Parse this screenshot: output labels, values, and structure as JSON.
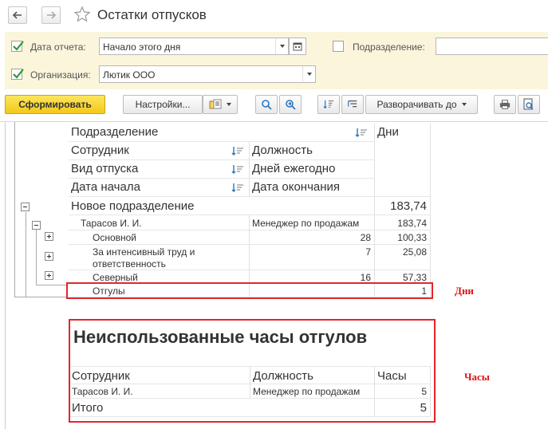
{
  "window": {
    "title": "Остатки отпусков"
  },
  "filters": {
    "report_date": {
      "label": "Дата отчета:",
      "value": "Начало этого дня",
      "checked": true
    },
    "organization": {
      "label": "Организация:",
      "value": "Лютик ООО",
      "checked": true
    },
    "department": {
      "label": "Подразделение:",
      "value": "",
      "checked": false
    }
  },
  "toolbar": {
    "generate_label": "Сформировать",
    "settings_label": "Настройки...",
    "expand_label": "Разворачивать до"
  },
  "report": {
    "headers": {
      "department": "Подразделение",
      "days": "Дни",
      "employee": "Сотрудник",
      "position": "Должность",
      "vacation_type": "Вид отпуска",
      "annual_days": "Дней ежегодно",
      "start_date": "Дата начала",
      "end_date": "Дата окончания"
    },
    "group": {
      "name": "Новое подразделение",
      "days": "183,74"
    },
    "employee": {
      "name": "Тарасов И. И.",
      "position": "Менеджер по продажам",
      "days": "183,74"
    },
    "rows": [
      {
        "type": "Основной",
        "annual": "28",
        "days": "100,33"
      },
      {
        "type": "За интенсивный труд и ответственность",
        "annual": "7",
        "days": "25,08"
      },
      {
        "type": "Северный",
        "annual": "16",
        "days": "57,33"
      },
      {
        "type": "Отгулы",
        "annual": "",
        "days": "1"
      }
    ],
    "annotation_days": "Дни"
  },
  "hours_report": {
    "title": "Неиспользованные часы отгулов",
    "headers": {
      "employee": "Сотрудник",
      "position": "Должность",
      "hours": "Часы"
    },
    "row": {
      "employee": "Тарасов И. И.",
      "position": "Менеджер по продажам",
      "hours": "5"
    },
    "total": {
      "label": "Итого",
      "hours": "5"
    },
    "annotation_hours": "Часы"
  },
  "colors": {
    "filter_panel_bg": "#fbf5dc",
    "primary_button": "#f3c91a",
    "highlight_red": "#e3262b",
    "sort_icon_blue": "#2a78c8"
  }
}
